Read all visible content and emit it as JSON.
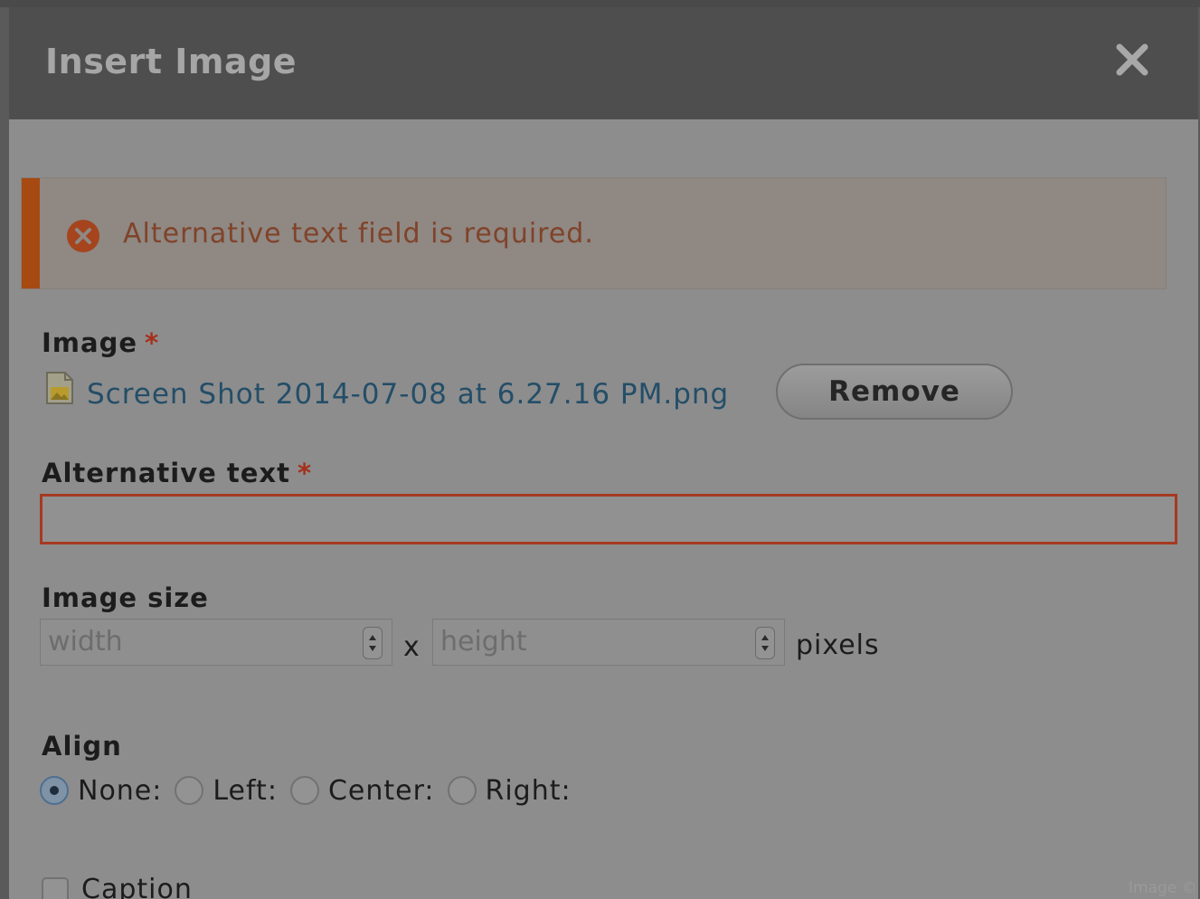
{
  "dialog": {
    "title": "Insert Image",
    "close_icon": "close-icon"
  },
  "error": {
    "icon": "error-circle-x-icon",
    "message": "Alternative text field is required.",
    "accent_color": "#a64a12"
  },
  "image_field": {
    "label": "Image",
    "required_mark": "*",
    "file_icon": "image-file-icon",
    "file_name": "Screen Shot 2014-07-08 at 6.27.16 PM.png",
    "remove_label": "Remove"
  },
  "alt_text": {
    "label": "Alternative text",
    "required_mark": "*",
    "value": "",
    "error_color": "#a63a22"
  },
  "image_size": {
    "label": "Image size",
    "width_placeholder": "width",
    "height_placeholder": "height",
    "separator": "x",
    "unit": "pixels"
  },
  "align": {
    "label": "Align",
    "options": [
      {
        "label": "None:",
        "checked": true
      },
      {
        "label": "Left:",
        "checked": false
      },
      {
        "label": "Center:",
        "checked": false
      },
      {
        "label": "Right:",
        "checked": false
      }
    ]
  },
  "caption": {
    "label": "Caption",
    "checked": false
  },
  "credit": "Image © Dr"
}
